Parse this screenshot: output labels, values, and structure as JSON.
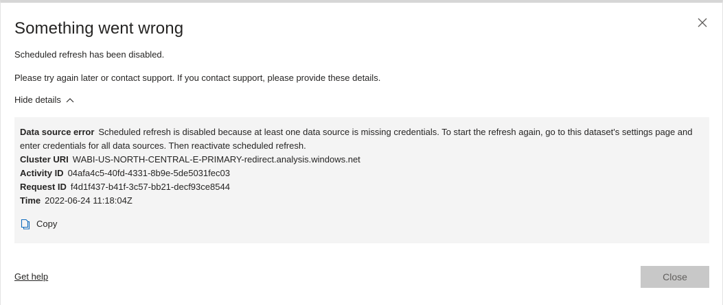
{
  "dialog": {
    "title": "Something went wrong",
    "message": "Scheduled refresh has been disabled.",
    "instructions": "Please try again later or contact support. If you contact support, please provide these details.",
    "toggle_label": "Hide details",
    "details": {
      "data_source_error_label": "Data source error",
      "data_source_error_value": "Scheduled refresh is disabled because at least one data source is missing credentials. To start the refresh again, go to this dataset's settings page and enter credentials for all data sources. Then reactivate scheduled refresh.",
      "cluster_uri_label": "Cluster URI",
      "cluster_uri_value": "WABI-US-NORTH-CENTRAL-E-PRIMARY-redirect.analysis.windows.net",
      "activity_id_label": "Activity ID",
      "activity_id_value": "04afa4c5-40fd-4331-8b9e-5de5031fec03",
      "request_id_label": "Request ID",
      "request_id_value": "f4d1f437-b41f-3c57-bb21-decf93ce8544",
      "time_label": "Time",
      "time_value": "2022-06-24 11:18:04Z",
      "copy_label": "Copy"
    },
    "get_help_label": "Get help",
    "close_label": "Close"
  },
  "icons": {
    "close": "close-icon",
    "chevron": "chevron-up-icon",
    "copy": "copy-icon"
  },
  "colors": {
    "text": "#252423",
    "details_bg": "#f4f4f4",
    "close_button_bg": "#c8c8c8",
    "close_button_text": "#605e5c"
  }
}
